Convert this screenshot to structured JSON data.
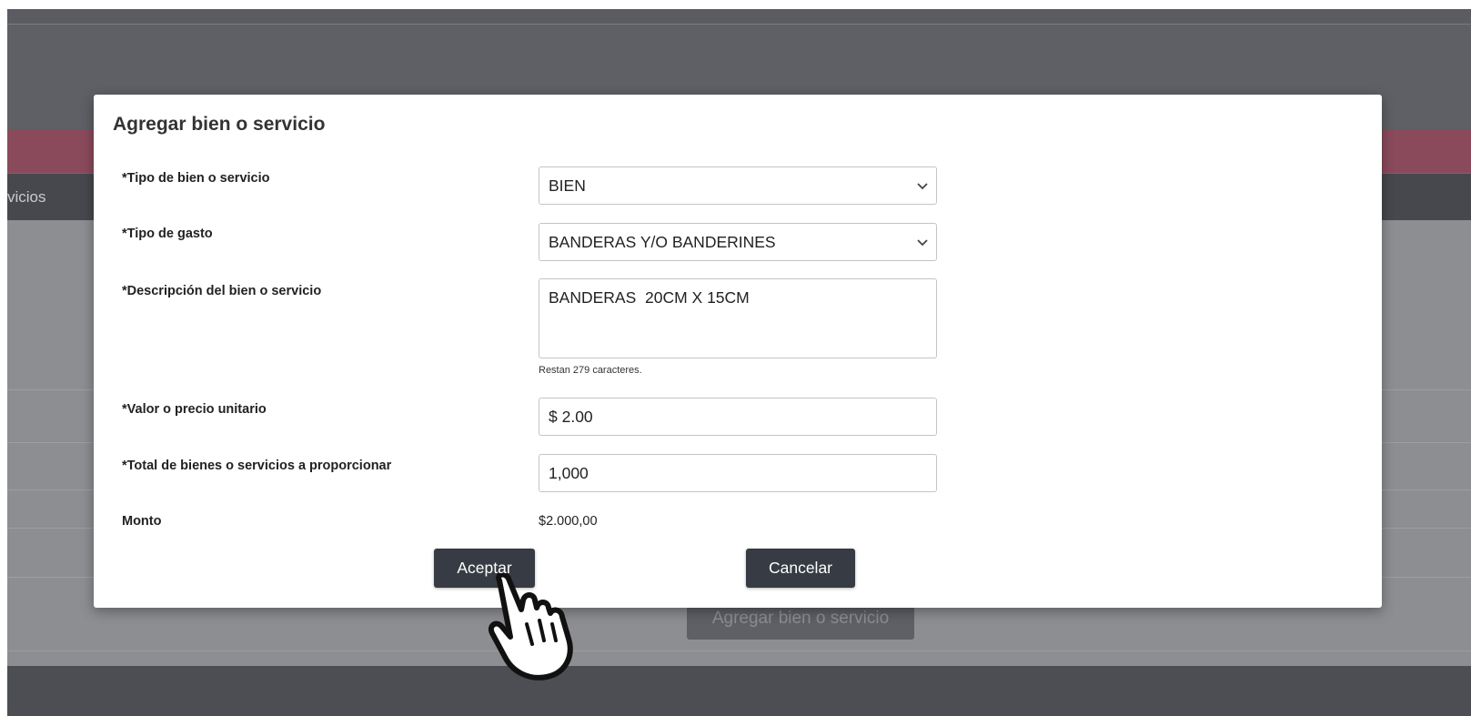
{
  "background": {
    "tab_partial": "vicios",
    "agregar_button_label": "Agregar bien o servicio"
  },
  "modal": {
    "title": "Agregar bien o servicio",
    "tipo_bien": {
      "label": "*Tipo de bien o servicio",
      "value": "BIEN"
    },
    "tipo_gasto": {
      "label": "*Tipo de gasto",
      "value": "BANDERAS Y/O BANDERINES"
    },
    "descripcion": {
      "label": "*Descripción del bien o servicio",
      "value": "BANDERAS  20CM X 15CM",
      "hint": "Restan 279 caracteres."
    },
    "valor": {
      "label": "*Valor o precio unitario",
      "value": "$ 2.00"
    },
    "total": {
      "label": "*Total de bienes o servicios a proporcionar",
      "value": "1,000"
    },
    "monto": {
      "label": "Monto",
      "value": "$2.000,00"
    },
    "accept_label": "Aceptar",
    "cancel_label": "Cancelar"
  },
  "icons": {
    "select_arrow": "chevron-down-icon",
    "cursor": "hand-pointer-icon"
  },
  "colors": {
    "button_bg": "#373b43",
    "overlay_bg": "#5e6066",
    "pink_banner": "#8a4a5c"
  }
}
